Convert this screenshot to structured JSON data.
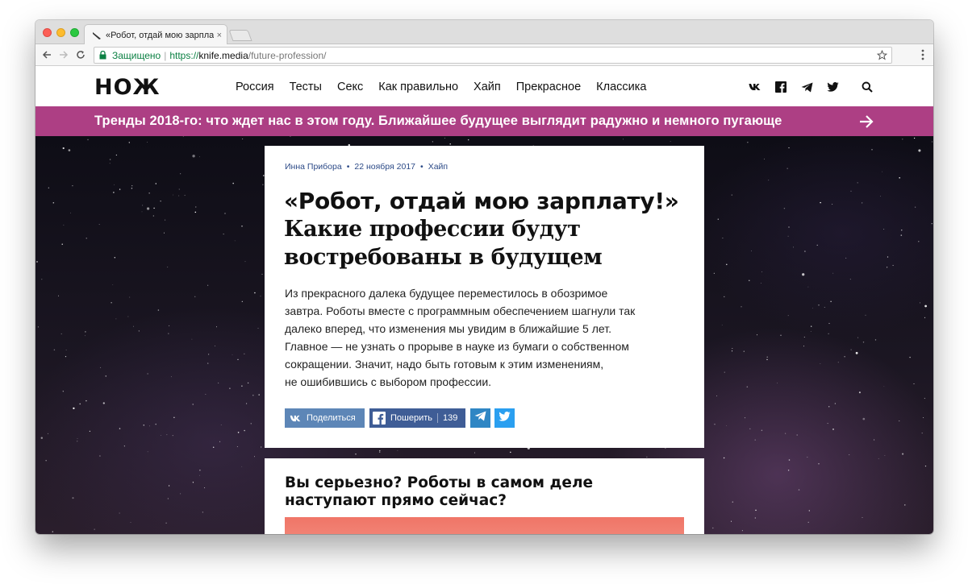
{
  "browser": {
    "tab_title": "«Робот, отдай мою зарплату!» Какие профессии будут востребованы в будущем",
    "tab_close": "×",
    "secure_label": "Защищено",
    "url_scheme": "https://",
    "url_host": "knife.media",
    "url_path": "/future-profession/"
  },
  "site": {
    "logo": "НОЖ",
    "nav": [
      "Россия",
      "Тесты",
      "Секс",
      "Как правильно",
      "Хайп",
      "Прекрасное",
      "Классика"
    ],
    "social_icons": [
      "vk-icon",
      "facebook-icon",
      "telegram-icon",
      "twitter-icon"
    ],
    "promo": "Тренды 2018-го: что ждет нас в этом году. Ближайшее будущее выглядит радужно и немного пугающе"
  },
  "article": {
    "author": "Инна Прибора",
    "date": "22 ноября 2017",
    "category": "Хайп",
    "title_bold": "«Робот, отдай мою зарплату!»",
    "title_rest": "Какие профессии будут востребованы в будущем",
    "lead": [
      "Из прекрасного далека будущее переместилось в обозримое",
      "завтра. Роботы вместе с программным обеспечением шагнули так",
      "далеко вперед, что изменения мы увидим в ближайшие 5 лет.",
      "Главное — не узнать о прорыве в науке из бумаги о собственном",
      "сокращении. Значит, надо быть готовым к этим изменениям,",
      "не ошибившись с выбором профессии."
    ],
    "share": {
      "vk_label": "Поделиться",
      "fb_label": "Пошерить",
      "fb_count": "139"
    },
    "section_title": "Вы серьезно? Роботы в самом деле наступают прямо сейчас?"
  },
  "colors": {
    "promo_bg": "#ad3f84",
    "vk": "#5d86b7",
    "facebook": "#3f5d96",
    "telegram": "#2f86c4",
    "twitter": "#2a9ff0"
  }
}
